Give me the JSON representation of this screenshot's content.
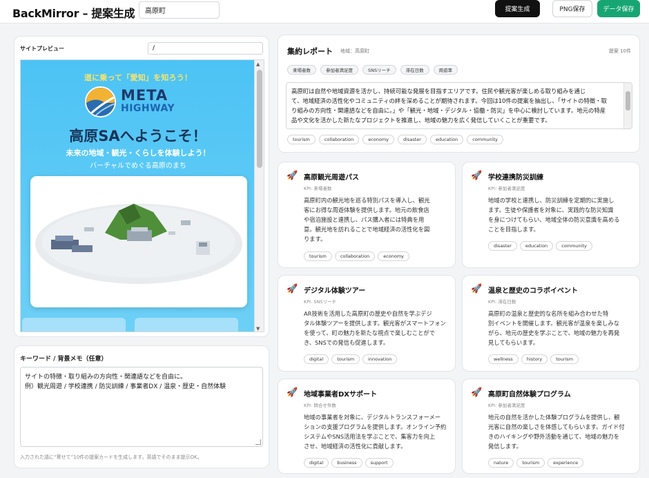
{
  "app": {
    "title": "BackMirror – 提案生成",
    "area_value": "高原町",
    "buttons": {
      "generate": "提案生成",
      "png_save": "PNG保存",
      "data_save": "データ保存"
    }
  },
  "preview": {
    "label": "サイトプレビュー",
    "path_value": "/",
    "site": {
      "tagline": "道に乗って「愛知」を知ろう！",
      "logo_line1": "META",
      "logo_line2": "HIGHWAY",
      "welcome": "高原SAへようこそ！",
      "sub1": "未来の地域・観光・くらしを体験しよう！",
      "sub2": "バーチャルでめぐる高原のまち"
    }
  },
  "keywords": {
    "label": "キーワード / 背景メモ（任意）",
    "value": "サイトの特徴・取り組みの方向性・関連語などを自由に。\n例）観光周遊 / 学校連携 / 防災訓練 / 事業者DX / 温泉・歴史・自然体験",
    "note": "入力された語に“寄せて”10件の提案カードを生成します。英語でそのまま提示OK。"
  },
  "summary": {
    "title": "集約レポート",
    "region": "地域：高原町",
    "count": "提案 10件",
    "kpis": [
      "来場者数",
      "参加者満足度",
      "SNSリーチ",
      "滞在日数",
      "周遊率"
    ],
    "text_lines": [
      "高原町は自然や地域資源を活かし、持続可能な発展を目指すエリアです。住民や観光客が楽しめる取り組みを通じ",
      "て、地域経済の活性化やコミュニティの絆を深めることが期待されます。今回は10件の提案を抽出し、「サイトの特徴・取",
      "り組みの方向性・関連語などを自由に。」や「観光・地域・デジタル・協働・防災」を中心に検討しています。地元の特産",
      "品や文化を活かした新たなプロジェクトを推進し、地域の魅力を広く発信していくことが重要です。"
    ],
    "tags": [
      "tourism",
      "collaboration",
      "economy",
      "disaster",
      "education",
      "community"
    ]
  },
  "proposals": [
    {
      "title": "高原観光周遊パス",
      "kpi": "KPI: 来場者数",
      "desc": [
        "高原町内の観光地を巡る特別パスを導入し、観光",
        "客にお得な周遊体験を提供します。地元の飲食店",
        "や宿泊施設と連携し、パス購入者には特典を用",
        "意。観光地を訪れることで地域経済の活性化を図",
        "ります。"
      ],
      "tags": [
        "tourism",
        "collaboration",
        "economy"
      ]
    },
    {
      "title": "学校連携防災訓練",
      "kpi": "KPI: 参加者満足度",
      "desc": [
        "地域の学校と連携し、防災訓練を定期的に実施し",
        "ます。生徒や保護者を対象に、実践的な防災知識",
        "を身につけてもらい、地域全体の防災意識を高める",
        "ことを目指します。"
      ],
      "tags": [
        "disaster",
        "education",
        "community"
      ]
    },
    {
      "title": "デジタル体験ツアー",
      "kpi": "KPI: SNSリーチ",
      "desc": [
        "AR技術を活用した高原町の歴史や自然を学ぶデジ",
        "タル体験ツアーを提供します。観光客がスマートフォン",
        "を使って、町の魅力を新たな視点で楽しむことがで",
        "き、SNSでの発信も促進します。"
      ],
      "tags": [
        "digital",
        "tourism",
        "innovation"
      ]
    },
    {
      "title": "温泉と歴史のコラボイベント",
      "kpi": "KPI: 滞在日数",
      "desc": [
        "高原町の温泉と歴史的な名所を組み合わせた特",
        "別イベントを開催します。観光客が温泉を楽しみな",
        "がら、地元の歴史を学ぶことで、地域の魅力を再発",
        "見してもらいます。"
      ],
      "tags": [
        "wellness",
        "history",
        "tourism"
      ]
    },
    {
      "title": "地域事業者DXサポート",
      "kpi": "KPI: 問合せ件数",
      "desc": [
        "地域の事業者を対象に、デジタルトランスフォーメー",
        "ションの支援プログラムを提供します。オンライン予約",
        "システムやSNS活用法を学ぶことで、集客力を向上",
        "させ、地域経済の活性化に貢献します。"
      ],
      "tags": [
        "digital",
        "business",
        "support"
      ]
    },
    {
      "title": "高原町自然体験プログラム",
      "kpi": "KPI: 参加者満足度",
      "desc": [
        "地元の自然を活かした体験プログラムを提供し、観",
        "光客に自然の楽しさを体感してもらいます。ガイド付",
        "きのハイキングや野外活動を通じて、地域の魅力を",
        "発信します。"
      ],
      "tags": [
        "nature",
        "tourism",
        "experience"
      ]
    }
  ]
}
